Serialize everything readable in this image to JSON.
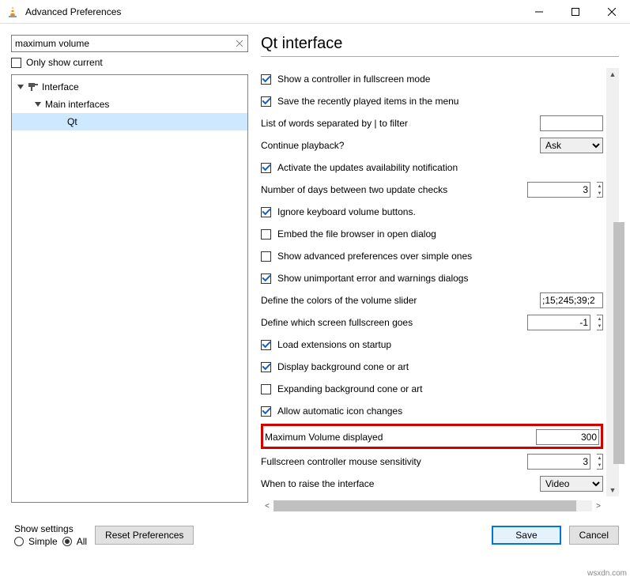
{
  "window": {
    "title": "Advanced Preferences"
  },
  "search": {
    "value": "maximum volume"
  },
  "only_show_current": {
    "label": "Only show current",
    "checked": false
  },
  "tree": {
    "interface": "Interface",
    "main_interfaces": "Main interfaces",
    "qt": "Qt"
  },
  "section_title": "Qt interface",
  "settings": {
    "fullscreen_controller": {
      "label": "Show a controller in fullscreen mode",
      "checked": true
    },
    "save_recent": {
      "label": "Save the recently played items in the menu",
      "checked": true
    },
    "filter_words": {
      "label": "List of words separated by | to filter",
      "value": ""
    },
    "continue_playback": {
      "label": "Continue playback?",
      "value": "Ask"
    },
    "updates_notify": {
      "label": "Activate the updates availability notification",
      "checked": true
    },
    "update_days": {
      "label": "Number of days between two update checks",
      "value": "3"
    },
    "ignore_kb_volume": {
      "label": "Ignore keyboard volume buttons.",
      "checked": true
    },
    "embed_file_browser": {
      "label": "Embed the file browser in open dialog",
      "checked": false
    },
    "adv_over_simple": {
      "label": "Show advanced preferences over simple ones",
      "checked": false
    },
    "show_unimportant": {
      "label": "Show unimportant error and warnings dialogs",
      "checked": true
    },
    "volume_colors": {
      "label": "Define the colors of the volume slider",
      "value": ";15;245;39;2"
    },
    "fullscreen_screen": {
      "label": "Define which screen fullscreen goes",
      "value": "-1"
    },
    "load_ext": {
      "label": "Load extensions on startup",
      "checked": true
    },
    "bg_cone": {
      "label": "Display background cone or art",
      "checked": true
    },
    "expand_cone": {
      "label": "Expanding background cone or art",
      "checked": false
    },
    "auto_icon": {
      "label": "Allow automatic icon changes",
      "checked": true
    },
    "max_volume": {
      "label": "Maximum Volume displayed",
      "value": "300"
    },
    "fs_sensitivity": {
      "label": "Fullscreen controller mouse sensitivity",
      "value": "3"
    },
    "raise_interface": {
      "label": "When to raise the interface",
      "value": "Video"
    }
  },
  "footer": {
    "show_settings": "Show settings",
    "simple": "Simple",
    "all": "All",
    "reset": "Reset Preferences",
    "save": "Save",
    "cancel": "Cancel"
  },
  "watermark": "wsxdn.com"
}
